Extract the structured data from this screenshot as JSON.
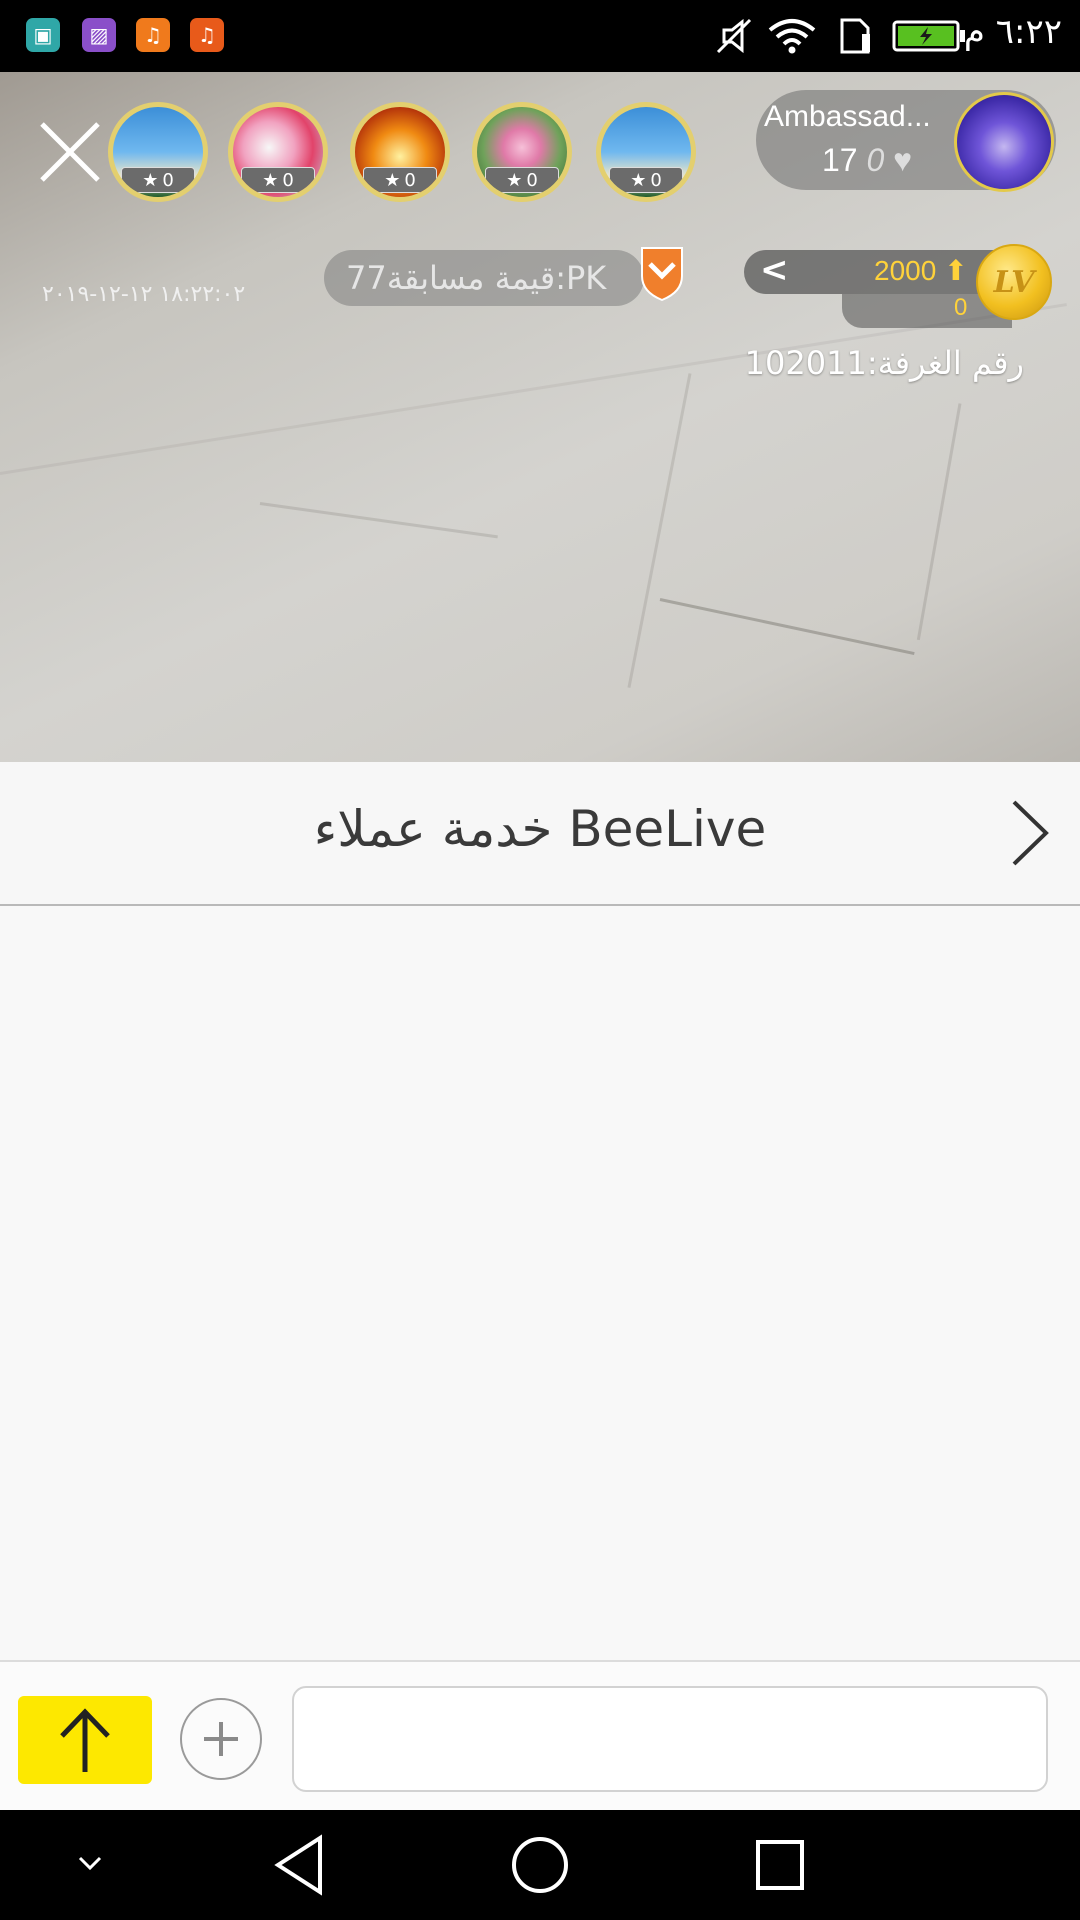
{
  "status_bar": {
    "time": "٦:٢٢ م",
    "apps": [
      {
        "icon": "android-icon",
        "color": "#2fa7a7"
      },
      {
        "icon": "gallery-icon",
        "color": "#8a4fc9"
      },
      {
        "icon": "music-icon",
        "color": "#f07a1c"
      },
      {
        "icon": "music-icon",
        "color": "#e85a1a"
      }
    ],
    "icons": [
      "mute-icon",
      "wifi-icon",
      "sim-icon",
      "battery-charging-icon"
    ]
  },
  "live": {
    "host": {
      "name": "Ambassad...",
      "likes": "17",
      "likes_extra": "0"
    },
    "viewers": [
      {
        "badge": "0",
        "theme": "beach"
      },
      {
        "badge": "0",
        "theme": "flowers"
      },
      {
        "badge": "0",
        "theme": "autumn"
      },
      {
        "badge": "0",
        "theme": "lotus"
      },
      {
        "badge": "0",
        "theme": "beach"
      }
    ],
    "pk_label": "قيمة مسابقة77:PK",
    "datetime": "١٨:٢٢:٠٢ ١٢-١٢-٢٠١٩",
    "level": {
      "score": "2000",
      "sub": "0",
      "badge": "LV"
    },
    "room_number": "رقم الغرفة:102011"
  },
  "chat": {
    "title": "خدمة عملاء BeeLive",
    "input_placeholder": ""
  },
  "colors": {
    "send_button": "#fde800",
    "level_text": "#ffd23a"
  }
}
